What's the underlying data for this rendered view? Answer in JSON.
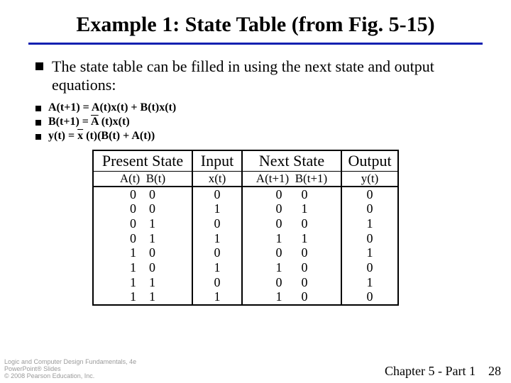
{
  "title": "Example 1: State Table (from Fig. 5-15)",
  "bullet_main": "The state table can be filled in using the next state and output equations:",
  "eq": {
    "a": "A(t+1) = A(t)x(t) + B(t)x(t)",
    "b_pre": "B(t+1) =  ",
    "b_bar": "A",
    "b_post": " (t)x(t)",
    "y_pre": "y(t) =  ",
    "y_bar": "x",
    "y_post": " (t)(B(t) + A(t))"
  },
  "headers": {
    "present_state": "Present State",
    "input": "Input",
    "next_state": "Next State",
    "output": "Output"
  },
  "sub": {
    "at": "A(t)",
    "bt": "B(t)",
    "xt": "x(t)",
    "at1": "A(t+1)",
    "bt1": "B(t+1)",
    "yt": "y(t)"
  },
  "chart_data": {
    "type": "table",
    "columns": [
      "A(t)",
      "B(t)",
      "x(t)",
      "A(t+1)",
      "B(t+1)",
      "y(t)"
    ],
    "rows": [
      {
        "at": "0",
        "bt": "0",
        "xt": "0",
        "at1": "0",
        "bt1": "0",
        "yt": "0"
      },
      {
        "at": "0",
        "bt": "0",
        "xt": "1",
        "at1": "0",
        "bt1": "1",
        "yt": "0"
      },
      {
        "at": "0",
        "bt": "1",
        "xt": "0",
        "at1": "0",
        "bt1": "0",
        "yt": "1"
      },
      {
        "at": "0",
        "bt": "1",
        "xt": "1",
        "at1": "1",
        "bt1": "1",
        "yt": "0"
      },
      {
        "at": "1",
        "bt": "0",
        "xt": "0",
        "at1": "0",
        "bt1": "0",
        "yt": "1"
      },
      {
        "at": "1",
        "bt": "0",
        "xt": "1",
        "at1": "1",
        "bt1": "0",
        "yt": "0"
      },
      {
        "at": "1",
        "bt": "1",
        "xt": "0",
        "at1": "0",
        "bt1": "0",
        "yt": "1"
      },
      {
        "at": "1",
        "bt": "1",
        "xt": "1",
        "at1": "1",
        "bt1": "0",
        "yt": "0"
      }
    ]
  },
  "footer": {
    "line1": "Logic and Computer Design Fundamentals, 4e",
    "line2": "PowerPoint® Slides",
    "line3": "© 2008 Pearson Education, Inc.",
    "chapter": "Chapter 5 - Part 1",
    "page": "28"
  }
}
